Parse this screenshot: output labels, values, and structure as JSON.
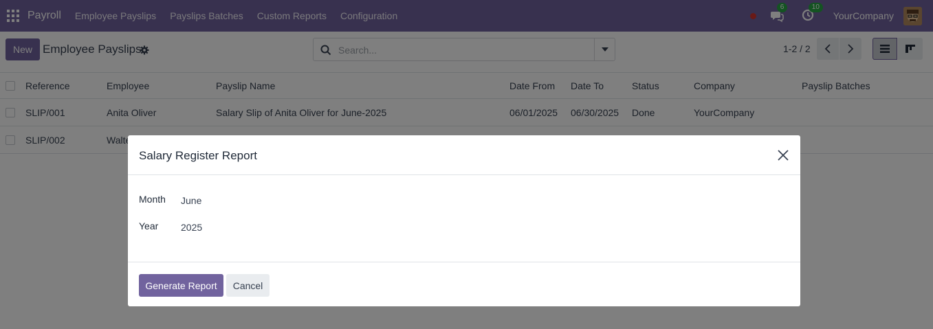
{
  "navbar": {
    "brand": "Payroll",
    "menu": [
      "Employee Payslips",
      "Payslips Batches",
      "Custom Reports",
      "Configuration"
    ],
    "messages_count": "6",
    "activities_count": "10",
    "company": "YourCompany",
    "color": "#71639e"
  },
  "control": {
    "new_label": "New",
    "title": "Employee Payslips",
    "search_placeholder": "Search...",
    "pager": "1-2 / 2"
  },
  "table": {
    "columns": [
      "Reference",
      "Employee",
      "Payslip Name",
      "Date From",
      "Date To",
      "Status",
      "Company",
      "Payslip Batches"
    ],
    "rows": [
      {
        "reference": "SLIP/001",
        "employee": "Anita Oliver",
        "name": "Salary Slip of Anita Oliver for June-2025",
        "date_from": "06/01/2025",
        "date_to": "06/30/2025",
        "status": "Done",
        "company": "YourCompany",
        "batch": ""
      },
      {
        "reference": "SLIP/002",
        "employee": "Walte",
        "name": "",
        "date_from": "",
        "date_to": "",
        "status": "",
        "company": "",
        "batch": ""
      }
    ]
  },
  "modal": {
    "title": "Salary Register Report",
    "month_label": "Month",
    "month_value": "June",
    "year_label": "Year",
    "year_value": "2025",
    "generate_label": "Generate Report",
    "cancel_label": "Cancel"
  }
}
